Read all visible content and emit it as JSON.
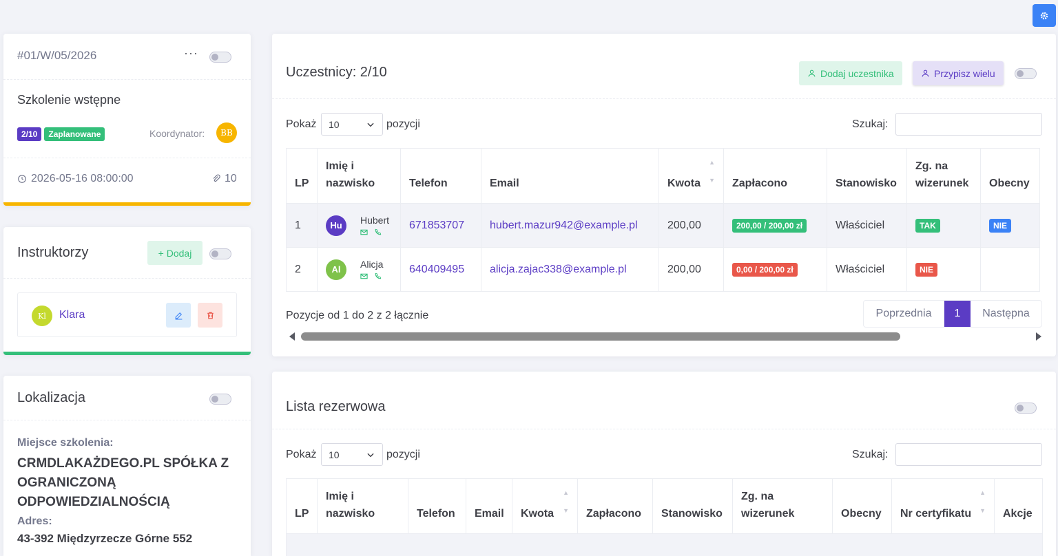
{
  "event": {
    "code": "#01/W/05/2026",
    "title": "Szkolenie wstępne",
    "count_badge": "2/10",
    "status_badge": "Zaplanowane",
    "coordinator_label": "Koordynator:",
    "coordinator_initials": "BB",
    "datetime": "2026-05-16 08:00:00",
    "attachments": "10"
  },
  "instructors": {
    "title": "Instruktorzy",
    "add_label": "+ Dodaj",
    "items": [
      {
        "initials": "Kl",
        "name": "Klara"
      }
    ]
  },
  "location": {
    "title": "Lokalizacja",
    "place_label": "Miejsce szkolenia:",
    "place_value": "CRMDLAKAŻDEGO.PL SPÓŁKA Z OGRANICZONĄ ODPOWIEDZIALNOŚCIĄ",
    "address_label": "Adres:",
    "address_value": "43-392 Międzyrzecze Górne 552"
  },
  "participants": {
    "title": "Uczestnicy: 2/10",
    "add_label": "Dodaj uczestnika",
    "assign_label": "Przypisz wielu",
    "show_label": "Pokaż",
    "page_size": "10",
    "entries_label": "pozycji",
    "search_label": "Szukaj:",
    "columns": [
      "LP",
      "Imię i nazwisko",
      "Telefon",
      "Email",
      "Kwota",
      "Zapłacono",
      "Stanowisko",
      "Zg. na wizerunek",
      "Obecny"
    ],
    "rows": [
      {
        "lp": "1",
        "initials": "Hu",
        "name": "Hubert",
        "phone": "671853707",
        "email": "hubert.mazur942@example.pl",
        "amount": "200,00",
        "paid": "200,00 / 200,00 zł",
        "position": "Właściciel",
        "consent": "TAK",
        "present": "NIE"
      },
      {
        "lp": "2",
        "initials": "Al",
        "name": "Alicja",
        "phone": "640409495",
        "email": "alicja.zajac338@example.pl",
        "amount": "200,00",
        "paid": "0,00 / 200,00 zł",
        "position": "Właściciel",
        "consent": "NIE",
        "present": ""
      }
    ],
    "info": "Pozycje od 1 do 2 z 2 łącznie",
    "pager": {
      "prev": "Poprzednia",
      "current": "1",
      "next": "Następna"
    }
  },
  "reserve": {
    "title": "Lista rezerwowa",
    "show_label": "Pokaż",
    "page_size": "10",
    "entries_label": "pozycji",
    "search_label": "Szukaj:",
    "columns": [
      "LP",
      "Imię i nazwisko",
      "Telefon",
      "Email",
      "Kwota",
      "Zapłacono",
      "Stanowisko",
      "Zg. na wizerunek",
      "Obecny",
      "Nr certyfikatu",
      "Akcje"
    ]
  },
  "colors": {
    "accent": "#5b3cc4",
    "success": "#34bf7a",
    "warning": "#f7b500",
    "danger": "#e9574a",
    "info": "#3b82f6"
  }
}
